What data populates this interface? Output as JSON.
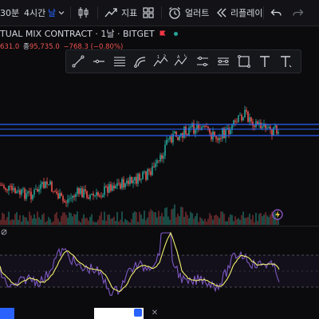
{
  "toolbar": {
    "interval_30": "30분",
    "interval_4h": "4시간",
    "interval_day": "날",
    "indicators_label": "지표",
    "alert_label": "얼러트",
    "replay_label": "리플레이"
  },
  "symbol": {
    "title": "TUAL MIX CONTRACT · 1날 · BITGET"
  },
  "prices": {
    "open_partial": "631.0",
    "close_label": "종",
    "close_value": "95,735.0",
    "change": "−768.3 (−0.80%)"
  },
  "drawing_tools": [
    "trend-line",
    "horizontal-ray",
    "parallel-channel",
    "curve",
    "elliott-wave-12345",
    "abcd-pattern",
    "price-range",
    "date-range",
    "rectangle",
    "text",
    "text-note"
  ],
  "colors": {
    "accent": "#2962ff",
    "up": "#26a69a",
    "down": "#ef5350",
    "rsi_line": "#7e57c2",
    "rsi_ma": "#f2ef6f",
    "level_band": "#2962ff"
  },
  "icons": {
    "candle": "candlestick-icon",
    "indicators": "indicators-fx-icon",
    "layout": "layout-grid-icon",
    "alert": "alarm-clock-icon",
    "replay": "replay-rewind-icon",
    "undo": "undo-icon",
    "redo": "redo-icon",
    "lightning": "lightning-icon"
  }
}
